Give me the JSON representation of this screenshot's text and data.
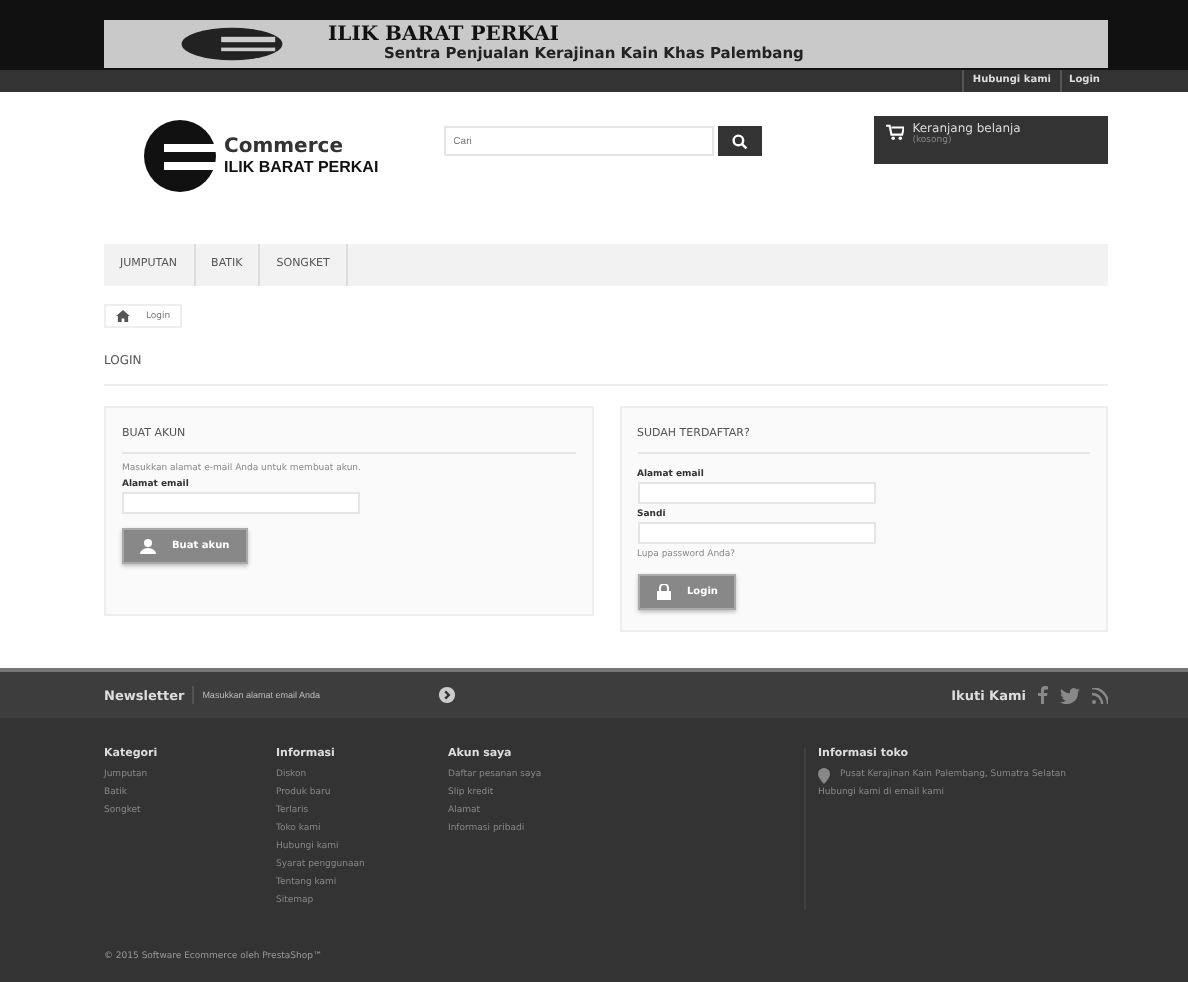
{
  "banner": {
    "title": "ILIK BARAT PERKAI",
    "subtitle": "Sentra Penjualan Kerajinan Kain Khas Palembang"
  },
  "top_links": [
    "Hubungi kami",
    "Login"
  ],
  "logo": {
    "word": "Commerce",
    "tagline": "ILIK BARAT PERKAI"
  },
  "search": {
    "placeholder": "Cari"
  },
  "cart": {
    "label": "Keranjang belanja",
    "status": "(kosong)"
  },
  "nav": [
    {
      "label": "JUMPUTAN"
    },
    {
      "label": "BATIK"
    },
    {
      "label": "SONGKET"
    }
  ],
  "breadcrumb": [
    "Login"
  ],
  "page_title": "LOGIN",
  "create_account": {
    "heading": "BUAT AKUN",
    "intro": "Masukkan alamat e-mail Anda untuk membuat akun.",
    "email_label": "Alamat email",
    "button": "Buat akun"
  },
  "login": {
    "heading": "SUDAH TERDAFTAR?",
    "email_label": "Alamat email",
    "password_label": "Sandi",
    "forgot": "Lupa password Anda?",
    "button": "Login"
  },
  "newsletter": {
    "title": "Newsletter",
    "placeholder": "Masukkan alamat email Anda"
  },
  "follow": {
    "title": "Ikuti Kami"
  },
  "footer_columns": [
    {
      "title": "Kategori",
      "links": [
        "Jumputan",
        "Batik",
        "Songket"
      ]
    },
    {
      "title": "Informasi",
      "links": [
        "Diskon",
        "Produk baru",
        "Terlaris",
        "Toko kami",
        "Hubungi kami",
        "Syarat penggunaan",
        "Tentang kami",
        "Sitemap"
      ]
    },
    {
      "title": "Akun saya",
      "links": [
        "Daftar pesanan saya",
        "Slip kredit",
        "Alamat",
        "Informasi pribadi"
      ]
    }
  ],
  "store_info": {
    "title": "Informasi toko",
    "address": "Pusat Kerajinan Kain Palembang, Sumatra Selatan",
    "contact": "Hubungi kami di email kami"
  },
  "copyright": "© 2015 Software Ecommerce oleh PrestaShop™"
}
